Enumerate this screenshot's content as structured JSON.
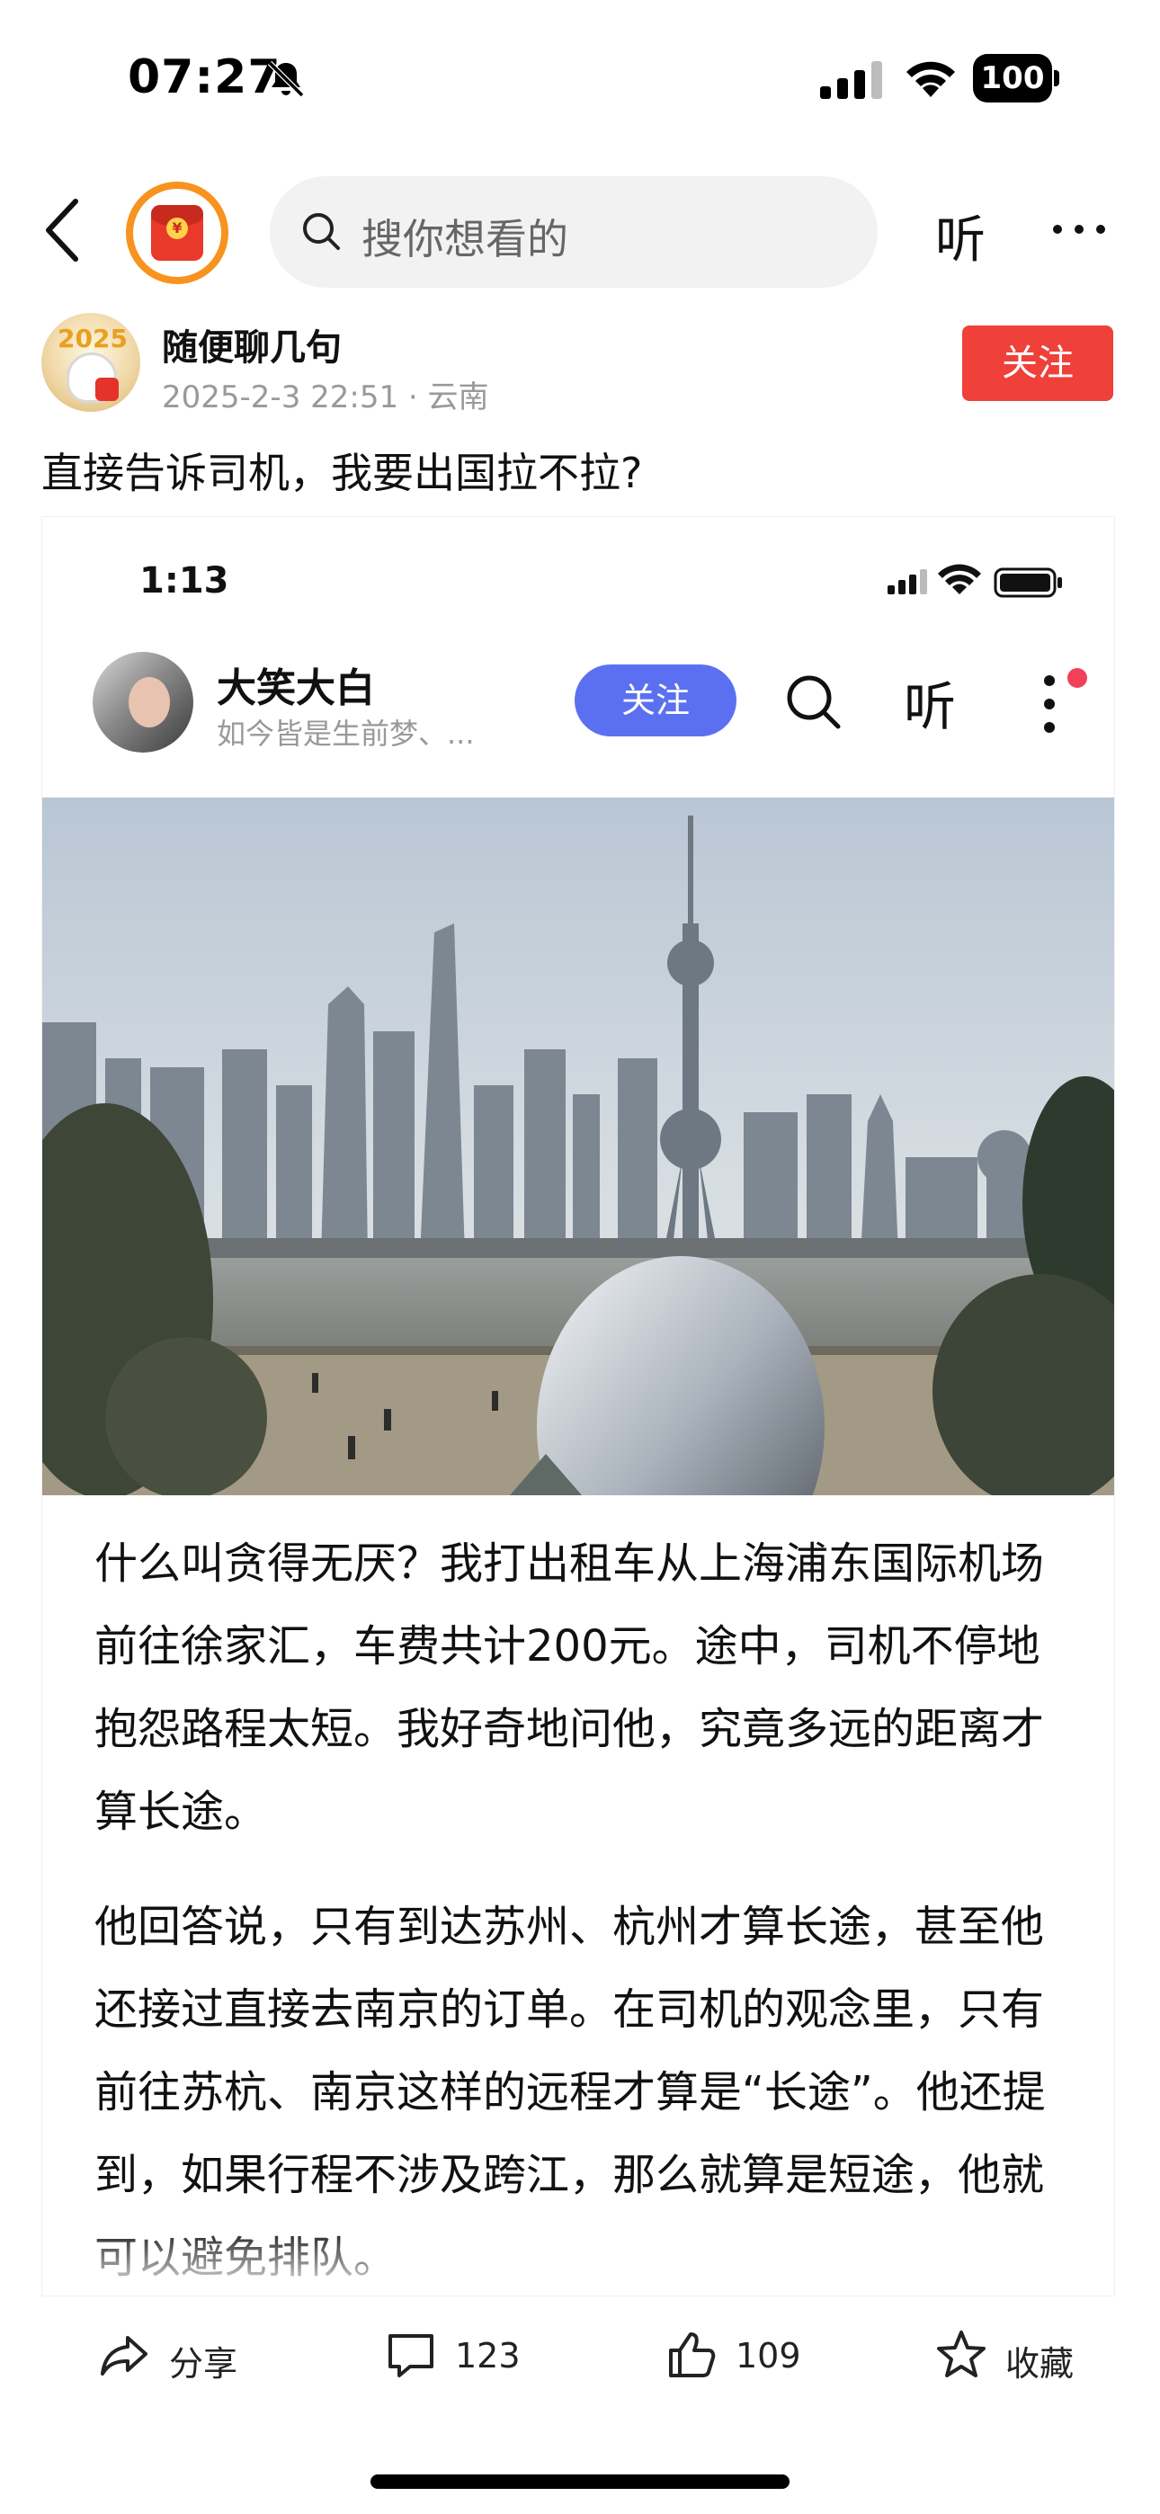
{
  "status_bar": {
    "time": "07:27",
    "battery": "100",
    "icons": [
      "bell-slash-icon",
      "signal-icon",
      "wifi-icon",
      "battery-icon"
    ]
  },
  "top_nav": {
    "back_icon": "chevron-left-icon",
    "red_packet_icon": "red-packet-icon",
    "red_packet_symbol": "¥",
    "search_placeholder": "搜你想看的",
    "listen_label": "听",
    "more_icon": "more-horizontal-icon"
  },
  "author": {
    "avatar_text": "2025",
    "name": "随便聊几句",
    "timestamp": "2025-2-3 22:51",
    "location": "云南",
    "meta": "2025-2-3 22:51 · 云南",
    "follow_label": "关注",
    "follow_color": "#f0403a"
  },
  "post": {
    "title": "直接告诉司机，我要出国拉不拉?"
  },
  "embedded": {
    "status_time": "1:13",
    "author_name": "大笑大白",
    "author_signature": "如今皆是生前梦、...",
    "follow_label": "关注",
    "follow_color": "#5b70f0",
    "listen_label": "听",
    "paragraphs": [
      "什么叫贪得无厌？我打出租车从上海浦东国际机场前往徐家汇，车费共计200元。途中，司机不停地抱怨路程太短。我好奇地问他，究竟多远的距离才算长途。",
      "他回答说，只有到达苏州、杭州才算长途，甚至他还接过直接去南京的订单。在司机的观念里，只有前往苏杭、南京这样的远程才算是“长途”。他还提到，如果行程不涉及跨江，那么就算是短途，他就可以避免排队。"
    ]
  },
  "actions": {
    "share_label": "分享",
    "comment_count": "123",
    "like_count": "109",
    "favorite_label": "收藏"
  }
}
